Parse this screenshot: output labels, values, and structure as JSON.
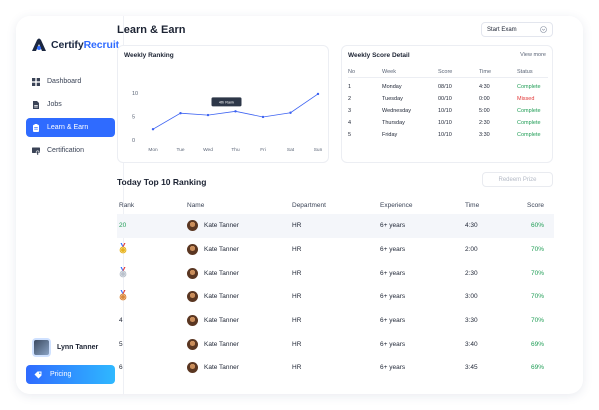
{
  "app": {
    "logo_part1": "Certify",
    "logo_part2": "Recruit"
  },
  "sidebar": {
    "items": [
      {
        "label": "Dashboard",
        "icon": "grid-icon"
      },
      {
        "label": "Jobs",
        "icon": "document-icon"
      },
      {
        "label": "Learn & Earn",
        "icon": "clipboard-icon",
        "active": true
      },
      {
        "label": "Certification",
        "icon": "certificate-icon"
      }
    ],
    "user_name": "Lynn Tanner",
    "pricing_label": "Pricing"
  },
  "header": {
    "title": "Learn & Earn",
    "exam_select": "Start Exam"
  },
  "weekly_ranking": {
    "title": "Weekly Ranking",
    "tooltip": "4th Rank",
    "chart_data": {
      "type": "line",
      "categories": [
        "Mon",
        "Tue",
        "Wed",
        "Thu",
        "Fri",
        "Sat",
        "Sun"
      ],
      "values": [
        2.3,
        5.7,
        5.3,
        6.1,
        4.9,
        5.8,
        9.8
      ],
      "ylim": [
        0,
        10
      ],
      "yticks": [
        0,
        5,
        10
      ],
      "color": "#3d63f2"
    }
  },
  "weekly_detail": {
    "title": "Weekly Score Detail",
    "view_more": "View more",
    "columns": [
      "No",
      "Week",
      "Score",
      "Time",
      "Status"
    ],
    "rows": [
      [
        "1",
        "Monday",
        "08/10",
        "4:30",
        "Complete"
      ],
      [
        "2",
        "Tuesday",
        "00/10",
        "0:00",
        "Missed"
      ],
      [
        "3",
        "Wednesday",
        "10/10",
        "5:00",
        "Complete"
      ],
      [
        "4",
        "Thursday",
        "10/10",
        "2:30",
        "Complete"
      ],
      [
        "5",
        "Friday",
        "10/10",
        "3:30",
        "Complete"
      ]
    ]
  },
  "ranking": {
    "title": "Today Top 10 Ranking",
    "redeem_label": "Redeem Prize",
    "columns": [
      "Rank",
      "Name",
      "Department",
      "Experience",
      "Time",
      "Score"
    ],
    "rows": [
      {
        "rank": "20",
        "medal": "",
        "name": "Kate Tanner",
        "dept": "HR",
        "exp": "6+ years",
        "time": "4:30",
        "score": "60%"
      },
      {
        "rank": "",
        "medal": "gold",
        "name": "Kate Tanner",
        "dept": "HR",
        "exp": "6+ years",
        "time": "2:00",
        "score": "70%"
      },
      {
        "rank": "",
        "medal": "silver",
        "name": "Kate Tanner",
        "dept": "HR",
        "exp": "6+ years",
        "time": "2:30",
        "score": "70%"
      },
      {
        "rank": "",
        "medal": "bronze",
        "name": "Kate Tanner",
        "dept": "HR",
        "exp": "6+ years",
        "time": "3:00",
        "score": "70%"
      },
      {
        "rank": "4",
        "medal": "",
        "name": "Kate Tanner",
        "dept": "HR",
        "exp": "6+ years",
        "time": "3:30",
        "score": "70%"
      },
      {
        "rank": "5",
        "medal": "",
        "name": "Kate Tanner",
        "dept": "HR",
        "exp": "6+ years",
        "time": "3:40",
        "score": "69%"
      },
      {
        "rank": "6",
        "medal": "",
        "name": "Kate Tanner",
        "dept": "HR",
        "exp": "6+ years",
        "time": "3:45",
        "score": "69%"
      }
    ]
  }
}
